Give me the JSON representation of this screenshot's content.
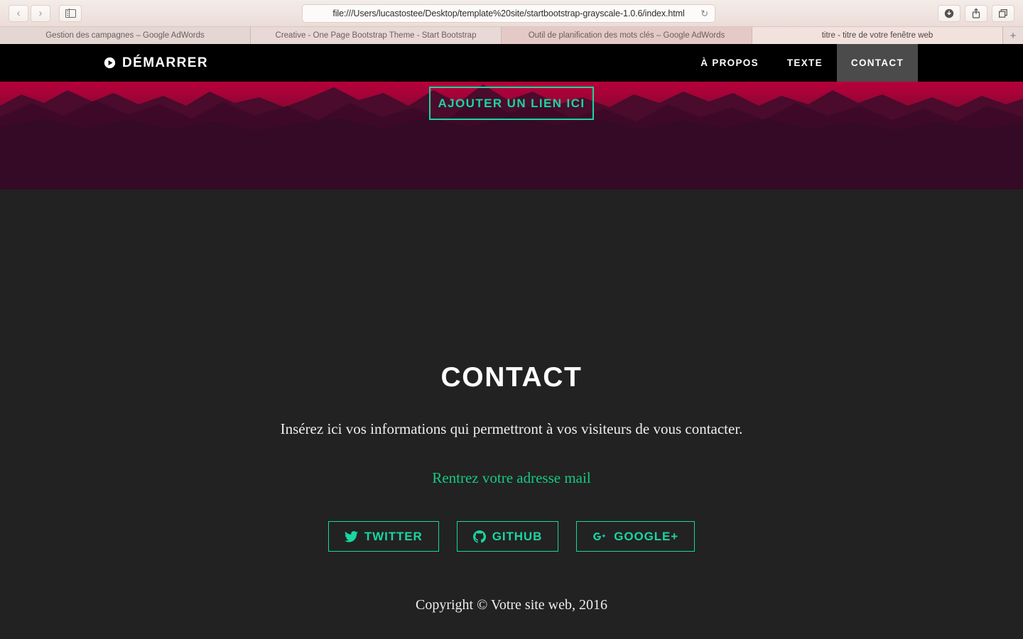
{
  "browser": {
    "back_label": "‹",
    "forward_label": "›",
    "sidebar_icon": "sidebar-icon",
    "url": "file:///Users/lucastostee/Desktop/template%20site/startbootstrap-grayscale-1.0.6/index.html",
    "reload_label": "↻",
    "download_icon": "download-icon",
    "share_icon": "share-icon",
    "tabs_icon": "tabs-overview-icon",
    "new_tab_label": "+",
    "tabs": [
      {
        "title": "Gestion des campagnes – Google AdWords",
        "active": false
      },
      {
        "title": "Creative - One Page Bootstrap Theme - Start Bootstrap",
        "active": false
      },
      {
        "title": "Outil de planification des mots clés – Google AdWords",
        "active": false
      },
      {
        "title": "titre - titre de votre fenêtre web",
        "active": true
      }
    ]
  },
  "site_nav": {
    "brand": "DÉMARRER",
    "brand_icon": "play-circle-icon",
    "links": [
      {
        "label": "À PROPOS",
        "active": false
      },
      {
        "label": "TEXTE",
        "active": false
      },
      {
        "label": "CONTACT",
        "active": true
      }
    ]
  },
  "hero": {
    "button_label": "AJOUTER UN LIEN ICI"
  },
  "contact": {
    "title": "CONTACT",
    "description": "Insérez ici vos informations qui permettront à vos visiteurs de vous contacter.",
    "mail_link": "Rentrez votre adresse mail",
    "social": [
      {
        "label": "TWITTER",
        "icon": "twitter-icon"
      },
      {
        "label": "GITHUB",
        "icon": "github-icon"
      },
      {
        "label": "GOOGLE+",
        "icon": "google-plus-icon"
      }
    ],
    "copyright": "Copyright © Votre site web, 2016"
  },
  "colors": {
    "accent_teal": "#19d6a0",
    "link_green": "#15c982",
    "nav_black": "#000000",
    "nav_active_gray": "#4b4b4b",
    "section_dark": "#222222",
    "hero_purple": "#340a26",
    "hero_crimson": "#b5003a"
  }
}
